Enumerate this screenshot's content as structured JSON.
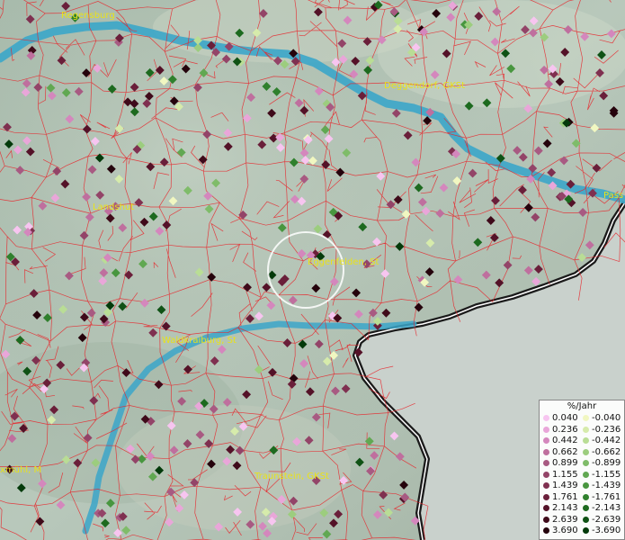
{
  "cities": {
    "regensburg": "Regensburg",
    "deggendorf": "Deggendorf, GKSt",
    "passau": "Pass",
    "landshut": "Landshut",
    "eggenfelden": "Eggenfelden, St",
    "waldkraiburg": "Waldkraiburg, St",
    "traunstein": "Traunstein, GKSt",
    "muehldorf": "xmühl, M"
  },
  "legend": {
    "title": "%/Jahr",
    "positive": [
      "0.040",
      "0.236",
      "0.442",
      "0.662",
      "0.899",
      "1.155",
      "1.439",
      "1.761",
      "2.143",
      "2.639",
      "3.690"
    ],
    "negative": [
      "-0.040",
      "-0.236",
      "-0.442",
      "-0.662",
      "-0.899",
      "-1.155",
      "-1.439",
      "-1.761",
      "-2.143",
      "-2.639",
      "-3.690"
    ],
    "positive_colors": [
      "#f7c5f0",
      "#e9a6d9",
      "#d487bd",
      "#bf6f9e",
      "#a85a82",
      "#934468",
      "#7f3050",
      "#6a1f3a",
      "#541228",
      "#3f0a1a",
      "#25030c"
    ],
    "negative_colors": [
      "#f1f7c1",
      "#d6ebab",
      "#b9dd95",
      "#9ccd7e",
      "#7fbc69",
      "#61a852",
      "#48963f",
      "#2f802d",
      "#1d6a1f",
      "#0f5215",
      "#033a0a"
    ]
  },
  "colors": {
    "river": "#3ba6c9",
    "border": "#1a1a1a",
    "district_lines": "#e8242a",
    "label": "#e9e21a",
    "highlight_circle": "#ffffff"
  }
}
